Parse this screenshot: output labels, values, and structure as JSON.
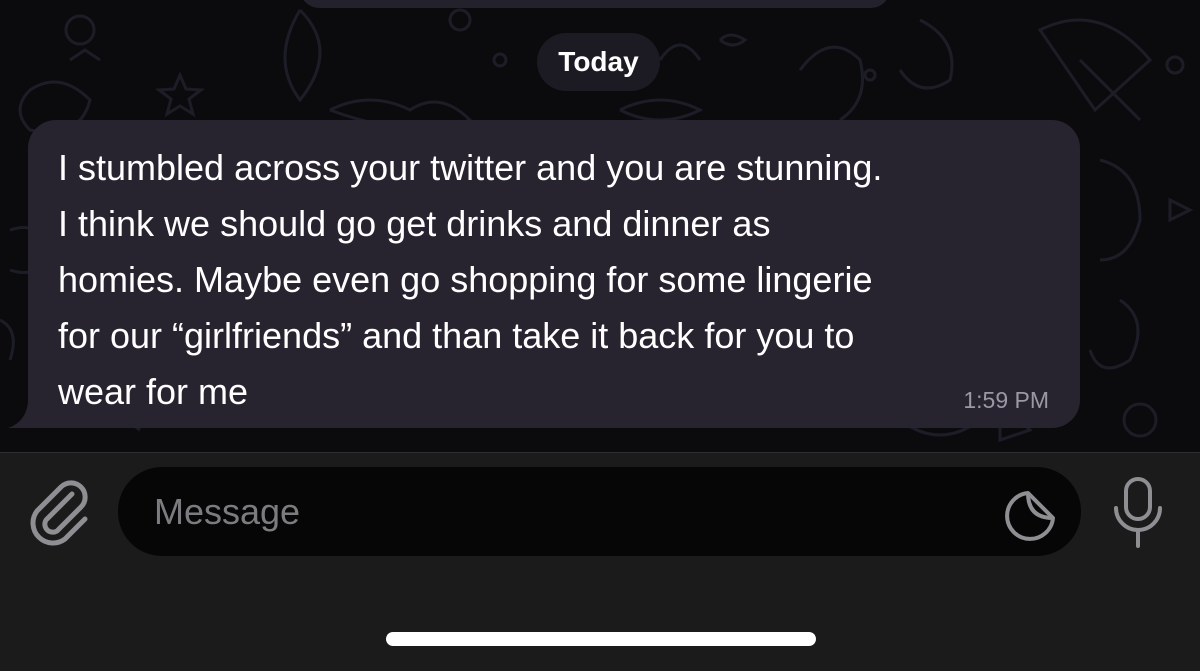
{
  "chat": {
    "date_separator": "Today",
    "message": {
      "text": "I stumbled across your twitter and you are stunning.\nI think we should go get drinks and dinner as\nhomies. Maybe even go shopping for some lingerie\nfor our “girlfriends” and than take it back for you to\nwear for me",
      "time": "1:59 PM"
    }
  },
  "composer": {
    "placeholder": "Message",
    "icons": {
      "attach": "paperclip-icon",
      "sticker": "sticker-icon",
      "voice": "microphone-icon"
    }
  },
  "colors": {
    "background": "#0b0b0e",
    "bubble": "#27242f",
    "timestamp": "#9b98a6",
    "composer_bar": "#1b1b1b",
    "input_field": "#060606",
    "placeholder": "#7c7c80",
    "icon": "#8e8e93"
  }
}
